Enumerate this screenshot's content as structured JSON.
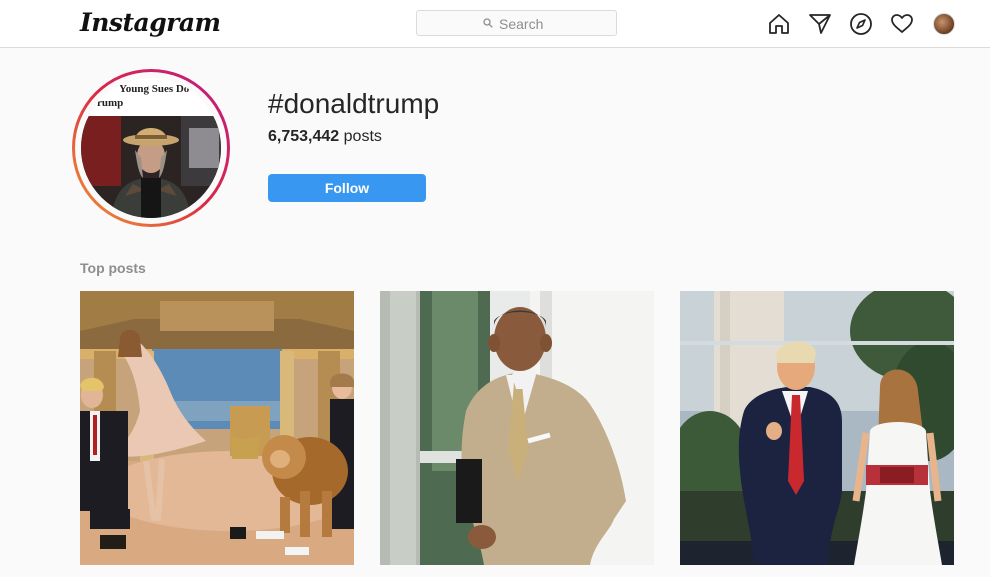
{
  "nav": {
    "logo": "Instagram",
    "search_placeholder": "Search",
    "icons": [
      "home-icon",
      "direct-icon",
      "explore-icon",
      "activity-icon",
      "profile-avatar"
    ]
  },
  "profile_pic": {
    "headline_line1": "Young Sues Do",
    "headline_line2": "rump"
  },
  "hashtag": {
    "title": "#donaldtrump",
    "post_count": "6,753,442",
    "post_label": "posts",
    "follow_label": "Follow"
  },
  "top_posts": {
    "heading": "Top posts",
    "items": [
      "post-family-penthouse",
      "post-man-tan-suit",
      "post-couple-ceremony"
    ]
  },
  "colors": {
    "follow_blue": "#3897f0",
    "border": "#dbdbdb",
    "background": "#fafafa",
    "muted_text": "#8e8e8e"
  }
}
